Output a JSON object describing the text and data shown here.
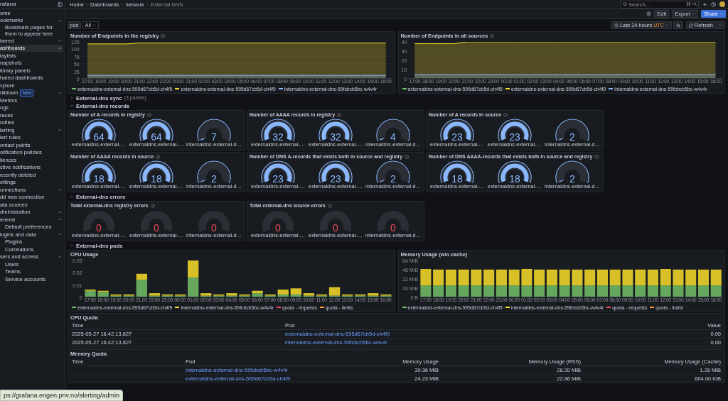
{
  "sidebar": {
    "title": "rafana",
    "items": [
      {
        "label": "ome",
        "selected": false
      },
      {
        "label": "ookmarks",
        "selected": false,
        "expanded": true,
        "children": [
          {
            "label": "Bookmark pages for them to appear here",
            "kind": "note",
            "selected": false
          }
        ]
      },
      {
        "label": "tarred",
        "selected": false,
        "expanded": false
      },
      {
        "label": "ashboards",
        "selected": true,
        "expanded": true
      },
      {
        "label": "laylists",
        "selected": false
      },
      {
        "label": "napshots",
        "selected": false
      },
      {
        "label": "ibrary panels",
        "selected": false
      },
      {
        "label": "hared dashboards",
        "selected": false
      },
      {
        "label": "xplore",
        "selected": false
      },
      {
        "label": "rilldown",
        "selected": false,
        "badge": "New",
        "expanded": true
      },
      {
        "label": "Metrics",
        "selected": false
      },
      {
        "label": "ogs",
        "selected": false
      },
      {
        "label": "races",
        "selected": false
      },
      {
        "label": "rofiles",
        "selected": false
      },
      {
        "label": "lerting",
        "selected": false,
        "expanded": true
      },
      {
        "label": "lert rules",
        "selected": false
      },
      {
        "label": "ontact points",
        "selected": false
      },
      {
        "label": "otification policies",
        "selected": false
      },
      {
        "label": "ilences",
        "selected": false
      },
      {
        "label": "ctive notifications",
        "selected": false
      },
      {
        "label": "ecently deleted",
        "selected": false
      },
      {
        "label": "ettings",
        "selected": false
      },
      {
        "label": "onnections",
        "selected": false,
        "expanded": true
      },
      {
        "label": "dd new connection",
        "selected": false
      },
      {
        "label": "ata sources",
        "selected": false
      },
      {
        "label": "dministration",
        "selected": false,
        "expanded": true
      },
      {
        "label": "eneral",
        "selected": false,
        "expanded": true,
        "children": [
          {
            "label": "Default preferences",
            "selected": false
          }
        ]
      },
      {
        "label": "lugins and data",
        "selected": false,
        "expanded": true,
        "children": [
          {
            "label": "Plugins",
            "selected": false
          },
          {
            "label": "Correlations",
            "selected": false
          }
        ]
      },
      {
        "label": "sers and access",
        "selected": false,
        "expanded": true,
        "children": [
          {
            "label": "Users",
            "selected": false
          },
          {
            "label": "Teams",
            "selected": false
          },
          {
            "label": "Service accounts",
            "selected": false
          }
        ]
      }
    ]
  },
  "topbar": {
    "breadcrumbs": [
      "Home",
      "Dashboards",
      "network",
      "External DNS"
    ],
    "search": {
      "placeholder": "Search...",
      "shortcut": "⌘+k"
    }
  },
  "toolbar": {
    "buttons": [
      {
        "label": "Edit",
        "kind": "plain"
      },
      {
        "label": "Export",
        "kind": "dropdown"
      },
      {
        "label": "Share",
        "kind": "primary"
      }
    ]
  },
  "controls": {
    "variable": {
      "label": "pod",
      "value": "All"
    },
    "time_range": {
      "label": "Last 24 hours",
      "badge": "UTC"
    },
    "refresh": {
      "label": "Refresh"
    }
  },
  "sections": [
    {
      "kind": "charts",
      "panels": [
        {
          "title": "Number of Endpoints in the registry",
          "chart_data": {
            "type": "area",
            "legend": "bottom",
            "grid": true,
            "categories": [
              "17:00",
              "18:00",
              "19:00",
              "20:00",
              "21:00",
              "22:00",
              "23:00",
              "00:00",
              "01:00",
              "02:00",
              "03:00",
              "04:00",
              "05:00",
              "06:00",
              "07:00",
              "08:00",
              "09:00",
              "10:00",
              "11:00",
              "12:00",
              "13:00",
              "14:00",
              "15:00",
              "16:00"
            ],
            "ylim": [
              0,
              125
            ],
            "yticks": [
              0,
              25,
              50,
              75,
              100,
              125
            ],
            "series": [
              {
                "name": "externaldns-external-dns-595d67cb5d-ch4f9",
                "color": "#73bf69",
                "values": [
                  null,
                  null,
                  null,
                  null,
                  null,
                  null,
                  null,
                  null,
                  null,
                  null,
                  null,
                  null,
                  null,
                  null,
                  null,
                  null,
                  null,
                  null,
                  null,
                  null,
                  null,
                  null,
                  null,
                  null
                ]
              },
              {
                "name": "externaldns-external-dns-595d67cb5d-ch4f9",
                "color": "#fade2a",
                "values": [
                  118,
                  118,
                  118,
                  118,
                  121,
                  121,
                  121,
                  121,
                  121,
                  121,
                  121,
                  121,
                  121,
                  121,
                  121,
                  121,
                  121,
                  121,
                  121,
                  121,
                  121,
                  121,
                  121,
                  121
                ]
              },
              {
                "name": "internaldns-external-dns-59fcbcb5bc-w4v4r",
                "color": "#8ab8ff",
                "values": [
                  10,
                  10,
                  10,
                  10,
                  10,
                  10,
                  10,
                  10,
                  10,
                  10,
                  10,
                  10,
                  10,
                  10,
                  10,
                  10,
                  10,
                  10,
                  10,
                  10,
                  10,
                  10,
                  10,
                  10
                ]
              }
            ]
          }
        },
        {
          "title": "Number of Endpoints in all sources",
          "chart_data": {
            "type": "area",
            "legend": "bottom",
            "grid": true,
            "categories": [
              "17:00",
              "18:00",
              "19:00",
              "20:00",
              "21:00",
              "22:00",
              "23:00",
              "00:00",
              "01:00",
              "02:00",
              "03:00",
              "04:00",
              "05:00",
              "06:00",
              "07:00",
              "08:00",
              "09:00",
              "10:00",
              "11:00",
              "12:00",
              "13:00",
              "14:00",
              "15:00",
              "16:00"
            ],
            "ylim": [
              0,
              40
            ],
            "yticks": [
              0,
              10,
              20,
              30,
              40
            ],
            "series": [
              {
                "name": "externaldns-external-dns-595d67cb5d-ch4f9",
                "color": "#73bf69",
                "values": [
                  null,
                  null,
                  null,
                  null,
                  null,
                  null,
                  null,
                  null,
                  null,
                  null,
                  null,
                  null,
                  null,
                  null,
                  null,
                  null,
                  null,
                  null,
                  null,
                  null,
                  null,
                  null,
                  null,
                  null
                ]
              },
              {
                "name": "externaldns-external-dns-595d67cb5d-ch4f9",
                "color": "#fade2a",
                "values": [
                  38,
                  38,
                  38,
                  38,
                  40,
                  40,
                  40,
                  40,
                  40,
                  40,
                  40,
                  40,
                  40,
                  40,
                  40,
                  40,
                  40,
                  40,
                  40,
                  40,
                  40,
                  40,
                  40,
                  40
                ]
              },
              {
                "name": "internaldns-external-dns-59fcbcb5bc-w4v4r",
                "color": "#8ab8ff",
                "values": [
                  4,
                  4,
                  4,
                  4,
                  4,
                  4,
                  4,
                  4,
                  4,
                  4,
                  4,
                  4,
                  4,
                  4,
                  4,
                  4,
                  4,
                  4,
                  4,
                  4,
                  4,
                  4,
                  4,
                  4
                ]
              }
            ]
          }
        }
      ]
    },
    {
      "kind": "row",
      "title": "External-dns sync",
      "note": "(3 panels)",
      "expanded": false
    },
    {
      "kind": "row",
      "title": "External-dns records",
      "expanded": true
    },
    {
      "kind": "gauges",
      "panels": [
        {
          "title": "Number of A records in registry",
          "show_threshold": true,
          "gauges": [
            {
              "value": "64",
              "label": "externaldns-external-…",
              "level": 1,
              "color": "#8ab8ff"
            },
            {
              "value": "64",
              "label": "externaldns-external-…",
              "level": 1,
              "color": "#8ab8ff"
            },
            {
              "value": "7",
              "label": "internaldns-external-d…",
              "level": 0.02,
              "color": "#8ab8ff"
            }
          ]
        },
        {
          "title": "Number of AAAA records in registry",
          "show_threshold": true,
          "gauges": [
            {
              "value": "32",
              "label": "externaldns-external-…",
              "level": 1,
              "color": "#8ab8ff"
            },
            {
              "value": "32",
              "label": "externaldns-external-…",
              "level": 1,
              "color": "#8ab8ff"
            },
            {
              "value": "4",
              "label": "internaldns-external-d…",
              "level": 0.02,
              "color": "#8ab8ff"
            }
          ]
        },
        {
          "title": "Number of A records in source",
          "show_threshold": true,
          "gauges": [
            {
              "value": "23",
              "label": "externaldns-external-…",
              "level": 1,
              "color": "#8ab8ff"
            },
            {
              "value": "23",
              "label": "externaldns-external-…",
              "level": 1,
              "color": "#8ab8ff"
            },
            {
              "value": "2",
              "label": "internaldns-external-d…",
              "level": 0.02,
              "color": "#8ab8ff"
            }
          ]
        },
        {
          "title": "Number of AAAA records in source",
          "show_threshold": true,
          "gauges": [
            {
              "value": "18",
              "label": "externaldns-external-…",
              "level": 1,
              "color": "#8ab8ff"
            },
            {
              "value": "18",
              "label": "externaldns-external-…",
              "level": 1,
              "color": "#8ab8ff"
            },
            {
              "value": "2",
              "label": "internaldns-external-d…",
              "level": 0.02,
              "color": "#8ab8ff"
            }
          ]
        },
        {
          "title": "Number of DNS A-records that exists both in source and registry",
          "show_threshold": true,
          "gauges": [
            {
              "value": "23",
              "label": "externaldns-external-…",
              "level": 1,
              "color": "#8ab8ff"
            },
            {
              "value": "23",
              "label": "externaldns-external-…",
              "level": 1,
              "color": "#8ab8ff"
            },
            {
              "value": "2",
              "label": "internaldns-external-d…",
              "level": 0.02,
              "color": "#8ab8ff"
            }
          ]
        },
        {
          "title": "Number of DNS AAAA-records that exists both in source and registry",
          "show_threshold": true,
          "gauges": [
            {
              "value": "18",
              "label": "externaldns-external-…",
              "level": 1,
              "color": "#8ab8ff"
            },
            {
              "value": "18",
              "label": "externaldns-external-…",
              "level": 1,
              "color": "#8ab8ff"
            },
            {
              "value": "2",
              "label": "internaldns-external-d…",
              "level": 0.02,
              "color": "#8ab8ff"
            }
          ]
        }
      ]
    },
    {
      "kind": "row",
      "title": "External-dns errors",
      "expanded": true
    },
    {
      "kind": "gauges",
      "panels": [
        {
          "title": "Total external-dns registry errors",
          "show_threshold": false,
          "gauges": [
            {
              "value": "0",
              "label": "externaldns-external-…",
              "level": 0,
              "color": "#f2495c"
            },
            {
              "value": "0",
              "label": "externaldns-external-…",
              "level": 0,
              "color": "#f2495c"
            },
            {
              "value": "0",
              "label": "internaldns-external-d…",
              "level": 0,
              "color": "#f2495c"
            }
          ]
        },
        {
          "title": "Total external-dns source errors",
          "show_threshold": false,
          "gauges": [
            {
              "value": "0",
              "label": "externaldns-external-…",
              "level": 0,
              "color": "#f2495c"
            },
            {
              "value": "0",
              "label": "externaldns-external-…",
              "level": 0,
              "color": "#f2495c"
            },
            {
              "value": "0",
              "label": "internaldns-external-d…",
              "level": 0,
              "color": "#f2495c"
            }
          ]
        }
      ]
    },
    {
      "kind": "row",
      "title": "External-dns pods",
      "expanded": true
    },
    {
      "kind": "charts",
      "panels": [
        {
          "title": "CPU Usage",
          "chart_data": {
            "type": "bar",
            "legend": "bottom",
            "grid": true,
            "stacked": true,
            "categories": [
              "17:00",
              "18:00",
              "19:00",
              "20:00",
              "21:00",
              "22:00",
              "23:00",
              "00:00",
              "01:00",
              "02:00",
              "03:00",
              "04:00",
              "05:00",
              "06:00",
              "07:00",
              "08:00",
              "09:00",
              "10:00",
              "11:00",
              "12:00",
              "13:00",
              "14:00",
              "15:00",
              "16:00"
            ],
            "ylim": [
              0,
              0.03
            ],
            "yticks": [
              0,
              0.01,
              0.02,
              0.03
            ],
            "series": [
              {
                "name": "externaldns-external-dns-595d67cb5d-ch4f9",
                "color": "#73bf69",
                "values": [
                  0.005,
                  0.004,
                  0.001,
                  0.001,
                  0.014,
                  0.001,
                  0.001,
                  0.001,
                  0.016,
                  0.001,
                  0.001,
                  0.001,
                  0.001,
                  0.003,
                  0.001,
                  0.002,
                  0.002,
                  0.001,
                  0.001,
                  0.001,
                  0.001,
                  0.001,
                  0.001,
                  0.001
                ]
              },
              {
                "name": "internaldns-external-dns-59fcbcb5bc-w4v4r",
                "color": "#fade2a",
                "values": [
                  0.001,
                  0.001,
                  0.001,
                  0.001,
                  0.005,
                  0.002,
                  0.001,
                  0.001,
                  0.014,
                  0.002,
                  0.001,
                  0.002,
                  0.001,
                  0.002,
                  0.001,
                  0.004,
                  0.005,
                  0.002,
                  0.001,
                  0.007,
                  0.001,
                  0.001,
                  0.002,
                  0.001
                ]
              },
              {
                "name": "quota - requests",
                "color": "#f2495c",
                "values": [
                  null,
                  null,
                  null,
                  null,
                  null,
                  null,
                  null,
                  null,
                  null,
                  null,
                  null,
                  null,
                  null,
                  null,
                  null,
                  null,
                  null,
                  null,
                  null,
                  null,
                  null,
                  null,
                  null,
                  null
                ]
              },
              {
                "name": "quota - limits",
                "color": "#ff9830",
                "values": [
                  null,
                  null,
                  null,
                  null,
                  null,
                  null,
                  null,
                  null,
                  null,
                  null,
                  null,
                  null,
                  null,
                  null,
                  null,
                  null,
                  null,
                  null,
                  null,
                  null,
                  null,
                  null,
                  null,
                  null
                ]
              }
            ]
          }
        },
        {
          "title": "Memory Usage (w/o cache)",
          "chart_data": {
            "type": "bar",
            "legend": "bottom",
            "grid": true,
            "stacked": true,
            "categories": [
              "17:00",
              "18:00",
              "19:00",
              "20:00",
              "21:00",
              "22:00",
              "23:00",
              "00:00",
              "01:00",
              "02:00",
              "03:00",
              "04:00",
              "05:00",
              "06:00",
              "07:00",
              "08:00",
              "09:00",
              "10:00",
              "11:00",
              "12:00",
              "13:00",
              "14:00",
              "15:00",
              "16:00"
            ],
            "ylim": [
              0,
              64
            ],
            "yticks": [
              {
                "value": 0,
                "label": "0 B"
              },
              {
                "value": 16,
                "label": "16 MiB"
              },
              {
                "value": 32,
                "label": "32 MiB"
              },
              {
                "value": 48,
                "label": "48 MiB"
              },
              {
                "value": 64,
                "label": "64 MiB"
              }
            ],
            "series": [
              {
                "name": "externaldns-external-dns-595d67cb5d-ch4f9",
                "color": "#73bf69",
                "values": [
                  20,
                  20,
                  20,
                  20,
                  20,
                  20,
                  20,
                  20,
                  20,
                  20,
                  20,
                  20,
                  20,
                  20,
                  20,
                  20,
                  20,
                  20,
                  20,
                  20,
                  20,
                  20,
                  20,
                  20
                ]
              },
              {
                "name": "internaldns-external-dns-59fcbcb5bc-w4v4r",
                "color": "#fade2a",
                "values": [
                  29,
                  28,
                  28,
                  28,
                  28,
                  28,
                  28,
                  28,
                  29,
                  28,
                  28,
                  28,
                  28,
                  28,
                  28,
                  28,
                  28,
                  28,
                  28,
                  29,
                  28,
                  28,
                  28,
                  28
                ]
              },
              {
                "name": "quota - requests",
                "color": "#f2495c",
                "values": [
                  null,
                  null,
                  null,
                  null,
                  null,
                  null,
                  null,
                  null,
                  null,
                  null,
                  null,
                  null,
                  null,
                  null,
                  null,
                  null,
                  null,
                  null,
                  null,
                  null,
                  null,
                  null,
                  null,
                  null
                ]
              },
              {
                "name": "quota - limits",
                "color": "#ff9830",
                "values": [
                  null,
                  null,
                  null,
                  null,
                  null,
                  null,
                  null,
                  null,
                  null,
                  null,
                  null,
                  null,
                  null,
                  null,
                  null,
                  null,
                  null,
                  null,
                  null,
                  null,
                  null,
                  null,
                  null,
                  null
                ]
              }
            ]
          }
        }
      ]
    },
    {
      "kind": "table",
      "title": "CPU Quota",
      "columns": [
        "Time",
        "Pod",
        "Value"
      ],
      "rows": [
        {
          "time": "2025-05-27 16:42:13.827",
          "pod": "externaldns-external-dns-595d67cb5d-ch4f9",
          "values": [
            "0.00"
          ]
        },
        {
          "time": "2025-05-27 16:42:13.827",
          "pod": "internaldns-external-dns-59fcbcb5bc-w4v4r",
          "values": [
            "0.00"
          ]
        }
      ]
    },
    {
      "kind": "table",
      "title": "Memory Quota",
      "columns": [
        "Time",
        "Pod",
        "Memory Usage",
        "Memory Usage (RSS)",
        "Memory Usage (Cache)"
      ],
      "rows": [
        {
          "pod": "internaldns-external-dns-59fcbcb5bc-w4v4r",
          "values": [
            "30.36 MiB",
            "28.20 MiB",
            "1.28 MiB"
          ]
        },
        {
          "pod": "externaldns-external-dns-595d67cb5d-ch4f9",
          "values": [
            "24.23 MiB",
            "22.86 MiB",
            "604.00 KiB"
          ]
        }
      ]
    }
  ],
  "status_url": "ps://grafana.engen.priv.no/alerting/admin"
}
